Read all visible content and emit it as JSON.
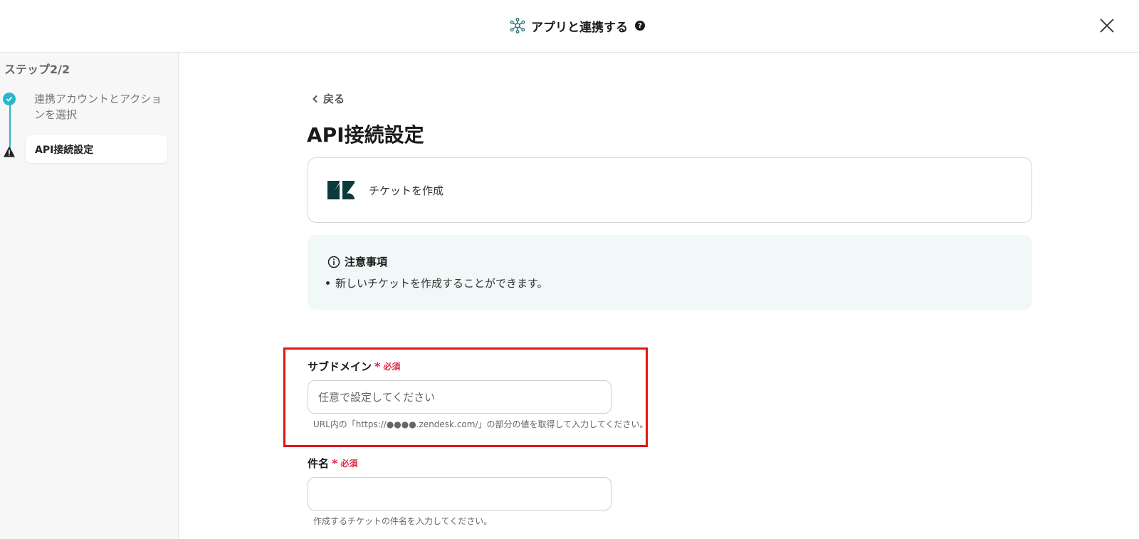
{
  "header": {
    "title": "アプリと連携する",
    "help_icon": "question-circle-icon",
    "close_icon": "close-icon"
  },
  "sidebar": {
    "step_label": "ステップ2/2",
    "steps": [
      {
        "label": "連携アカウントとアクションを選択",
        "status": "completed"
      },
      {
        "label": "API接続設定",
        "status": "warning"
      }
    ]
  },
  "main": {
    "back_label": "戻る",
    "title": "API接続設定",
    "action": {
      "app_icon": "zendesk-logo",
      "name": "チケットを作成"
    },
    "notice": {
      "title": "注意事項",
      "items": [
        "新しいチケットを作成することができます。"
      ]
    },
    "fields": [
      {
        "label": "サブドメイン",
        "required_mark": "*",
        "required_text": "必須",
        "value": "",
        "placeholder": "任意で設定してください",
        "hint": "URL内の「https://●●●●.zendesk.com/」の部分の値を取得して入力してください。"
      },
      {
        "label": "件名",
        "required_mark": "*",
        "required_text": "必須",
        "value": "",
        "placeholder": "",
        "hint": "作成するチケットの件名を入力してください。"
      }
    ]
  },
  "colors": {
    "accent": "#27b7c9",
    "required": "#e0294a",
    "highlight": "#e01515",
    "notice_bg": "#f0f8f8"
  }
}
